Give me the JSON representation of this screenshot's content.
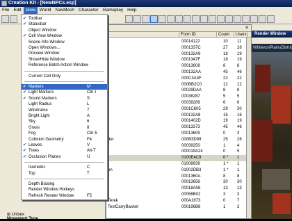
{
  "window": {
    "title": "Creation Kit - [NewNPCs.esp]"
  },
  "menubar": [
    "File",
    "Edit",
    "View",
    "World",
    "NavMesh",
    "Character",
    "Gameplay",
    "Help"
  ],
  "view_menu": [
    {
      "label": "Toolbar",
      "checked": true
    },
    {
      "label": "Statusbar",
      "checked": true
    },
    {
      "label": "Object Window",
      "checked": false
    },
    {
      "label": "Cell View Window",
      "checked": true
    },
    {
      "label": "Scene Info Window",
      "checked": false
    },
    {
      "label": "Open Windows...",
      "checked": false
    },
    {
      "label": "Preview Window",
      "checked": false
    },
    {
      "label": "Show/Hide Window",
      "checked": false
    },
    {
      "label": "Reference Batch Action Window",
      "checked": false,
      "shortcut": "-"
    },
    {
      "sep": true
    },
    {
      "label": "Current Cell Only",
      "checked": false
    },
    {
      "sep": true
    },
    {
      "label": "Markers",
      "checked": true,
      "shortcut": "M",
      "highlight": true
    },
    {
      "label": "Light Markers",
      "checked": true,
      "shortcut": "Ctrl-I"
    },
    {
      "label": "Sound Markers",
      "checked": true,
      "shortcut": "S"
    },
    {
      "label": "Light Radius",
      "checked": false,
      "shortcut": "L"
    },
    {
      "label": "Wireframe",
      "checked": false,
      "shortcut": "7"
    },
    {
      "label": "Bright Light",
      "checked": false,
      "shortcut": "A"
    },
    {
      "label": "Sky",
      "checked": false,
      "shortcut": "6"
    },
    {
      "label": "Grass",
      "checked": false,
      "shortcut": "8"
    },
    {
      "label": "Fog",
      "checked": false,
      "shortcut": "Ctrl-5"
    },
    {
      "label": "Collision Geometry",
      "checked": false,
      "shortcut": "F4"
    },
    {
      "label": "Leaves",
      "checked": true,
      "shortcut": "V"
    },
    {
      "label": "Trees",
      "checked": true,
      "shortcut": "Alt-T"
    },
    {
      "label": "Occlusion Planes",
      "checked": true,
      "shortcut": "U"
    },
    {
      "sep": true
    },
    {
      "label": "Isometric",
      "checked": false,
      "shortcut": "C"
    },
    {
      "label": "Top",
      "checked": false,
      "shortcut": "T"
    },
    {
      "sep": true
    },
    {
      "label": "Depth Biasing",
      "checked": false
    },
    {
      "label": "Render Window Hotkeys",
      "checked": false
    },
    {
      "label": "Refresh Render Window",
      "checked": false,
      "shortcut": "F5"
    }
  ],
  "list": {
    "headers": [
      "Form ID",
      "Count",
      "Users"
    ],
    "rows": [
      {
        "name": "",
        "form_id": "000141​22",
        "count": "10",
        "users": "11"
      },
      {
        "name": "",
        "form_id": "0001337C",
        "count": "27",
        "users": "28"
      },
      {
        "name": "",
        "form_id": "000132A9",
        "count": "18",
        "users": "19"
      },
      {
        "name": "",
        "form_id": "0001347F",
        "count": "18",
        "users": "19"
      },
      {
        "name": "",
        "form_id": "00013608",
        "count": "8",
        "users": "8"
      },
      {
        "name": "",
        "form_id": "000132AA",
        "count": "45",
        "users": "46"
      },
      {
        "name": "",
        "form_id": "000C3A3F",
        "count": "22",
        "users": "22"
      },
      {
        "name": "",
        "form_id": "000BB2C0",
        "count": "12",
        "users": "12"
      },
      {
        "name": "",
        "form_id": "00029DAA",
        "count": "8",
        "users": "8"
      },
      {
        "name": "",
        "form_id": "00038287",
        "count": "5",
        "users": "5"
      },
      {
        "name": "",
        "form_id": "00038289",
        "count": "6",
        "users": "6"
      },
      {
        "name": "",
        "form_id": "0001C605",
        "count": "29",
        "users": "30"
      },
      {
        "name": "",
        "form_id": "000132A8",
        "count": "15",
        "users": "16"
      },
      {
        "name": "",
        "form_id": "0001402D",
        "count": "19",
        "users": "19"
      },
      {
        "name": "",
        "form_id": "00013373",
        "count": "45",
        "users": "46"
      },
      {
        "name": "",
        "form_id": "00013609",
        "count": "0",
        "users": "3"
      },
      {
        "name": "der",
        "form_id": "000B3D99",
        "count": "25",
        "users": "26"
      },
      {
        "name": "",
        "form_id": "00039250",
        "count": "1",
        "users": "4"
      },
      {
        "name": "",
        "form_id": "000019A24",
        "count": "0",
        "users": "5"
      },
      {
        "name": "",
        "form_id": "0100E4C9",
        "count": "0 *",
        "users": "1",
        "selected": true
      },
      {
        "name": "",
        "form_id": "01008939",
        "count": "1 *",
        "users": "1"
      },
      {
        "name": "on",
        "form_id": "01002DB3",
        "count": "1 *",
        "users": "1"
      },
      {
        "name": "",
        "form_id": "0001360A",
        "count": "8",
        "users": "8"
      },
      {
        "name": "",
        "form_id": "00013656",
        "count": "30",
        "users": "30"
      },
      {
        "name": "",
        "form_id": "00018A08",
        "count": "13",
        "users": "13"
      },
      {
        "name": "",
        "form_id": "00056B02",
        "count": "3",
        "users": "3"
      },
      {
        "name": "Terek",
        "form_id": "000A1673",
        "count": "0",
        "users": "7"
      },
      {
        "name": "TestCarryBasket",
        "form_id": "000196B8",
        "count": "1",
        "users": "2"
      }
    ]
  },
  "left_tree": {
    "item": "Unixex",
    "label": "Movement Type"
  },
  "render_window": {
    "title": "Render Window",
    "cell_bar": "WhiterunPlainsDistrict"
  },
  "colors": {
    "accent": "#316ac5",
    "titlebar": "#1c3a7a"
  }
}
